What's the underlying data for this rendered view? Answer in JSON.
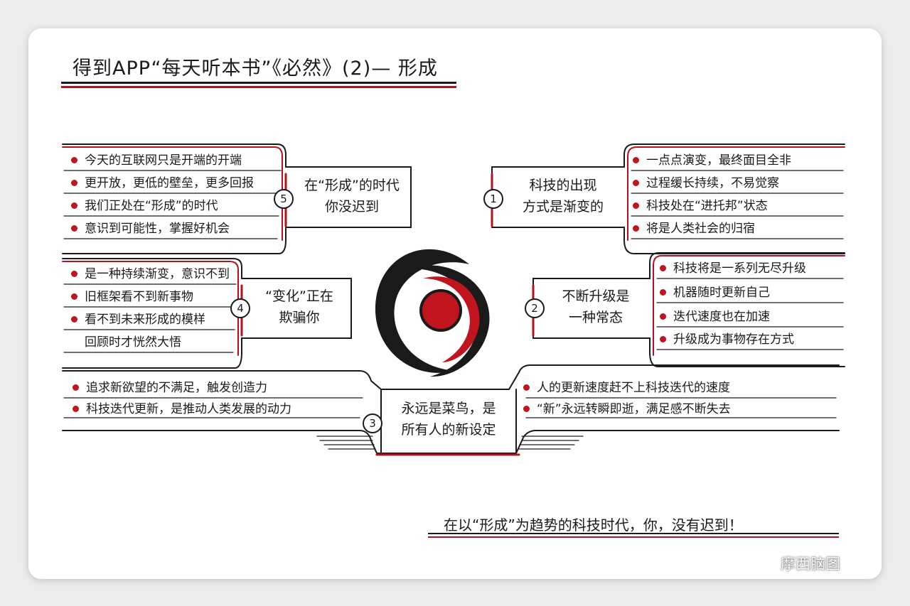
{
  "title": "得到APP“每天听本书”《必然》(2)— 形成",
  "center": {
    "colors": {
      "ink": "#1a1a1a",
      "accent": "#c0141f"
    }
  },
  "branches": {
    "b1": {
      "number": "1",
      "heading_lines": [
        "科技的出现",
        "方式是渐变的"
      ],
      "items": [
        "一点点演变，最终面目全非",
        "过程缓长持续，不易觉察",
        "科技处在“进托邦”状态",
        "将是人类社会的归宿"
      ]
    },
    "b2": {
      "number": "2",
      "heading_lines": [
        "不断升级是",
        "一种常态"
      ],
      "items": [
        "科技将是一系列无尽升级",
        "机器随时更新自己",
        "迭代速度也在加速",
        "升级成为事物存在方式"
      ]
    },
    "b3": {
      "number": "3",
      "heading_lines": [
        "永远是菜鸟，是",
        "所有人的新设定"
      ],
      "items_left": [
        "追求新欲望的不满足，触发创造力",
        "科技迭代更新，是推动人类发展的动力"
      ],
      "items_right": [
        "人的更新速度赶不上科技迭代的速度",
        "“新”永远转瞬即逝，满足感不断失去"
      ]
    },
    "b4": {
      "number": "4",
      "heading_lines": [
        "“变化”正在",
        "欺骗你"
      ],
      "items": [
        "是一种持续渐变，意识不到",
        "旧框架看不到新事物",
        "看不到未来形成的模样",
        "回顾时才恍然大悟"
      ]
    },
    "b5": {
      "number": "5",
      "heading_lines": [
        "在“形成”的时代",
        "你没迟到"
      ],
      "items": [
        "今天的互联网只是开端的开端",
        "更开放，更低的壁垒，更多回报",
        "我们正处在“形成”的时代",
        "意识到可能性，掌握好机会"
      ]
    }
  },
  "footer": "在以“形成”为趋势的科技时代，你，没有迟到！",
  "watermark": {
    "text": "摩西脑图",
    "icon": "wechat-icon"
  }
}
